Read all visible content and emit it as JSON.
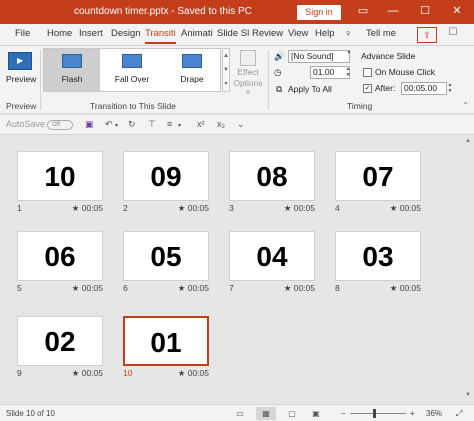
{
  "window": {
    "title": "countdown timer.pptx  -  Saved to this PC",
    "signin_label": "Sign in",
    "restore_icon": "restore-icon",
    "min_icon": "minimize-icon",
    "max_icon": "maximize-icon",
    "close_icon": "close-icon"
  },
  "tabs": [
    {
      "label": "File"
    },
    {
      "label": "Home"
    },
    {
      "label": "Insert"
    },
    {
      "label": "Design"
    },
    {
      "label": "Transiti"
    },
    {
      "label": "Animati"
    },
    {
      "label": "Slide Sl"
    },
    {
      "label": "Review"
    },
    {
      "label": "View"
    },
    {
      "label": "Help"
    }
  ],
  "tell_me": "Tell me",
  "ribbon": {
    "preview_label": "Preview",
    "preview_group": "Preview",
    "transitions": [
      {
        "label": "Flash",
        "selected": true
      },
      {
        "label": "Fall Over",
        "selected": false
      },
      {
        "label": "Drape",
        "selected": false
      }
    ],
    "transition_group": "Transition to This Slide",
    "effect_options_line1": "Effect",
    "effect_options_line2": "Options ˅",
    "sound_value": "[No Sound]",
    "duration_value": "01.00",
    "apply_to_all": "Apply To All",
    "advance_slide": "Advance Slide",
    "on_mouse_click": "On Mouse Click",
    "after_label": "After:",
    "after_value": "00:05.00",
    "timing_group": "Timing"
  },
  "qat": {
    "autosave_label": "AutoSave",
    "autosave_state": "Off",
    "superscript": "x²",
    "subscript": "x₂"
  },
  "slides": [
    {
      "number": "10",
      "index": "1",
      "duration": "00:05"
    },
    {
      "number": "09",
      "index": "2",
      "duration": "00:05"
    },
    {
      "number": "08",
      "index": "3",
      "duration": "00:05"
    },
    {
      "number": "07",
      "index": "4",
      "duration": "00:05"
    },
    {
      "number": "06",
      "index": "5",
      "duration": "00:05"
    },
    {
      "number": "05",
      "index": "6",
      "duration": "00:05"
    },
    {
      "number": "04",
      "index": "7",
      "duration": "00:05"
    },
    {
      "number": "03",
      "index": "8",
      "duration": "00:05"
    },
    {
      "number": "02",
      "index": "9",
      "duration": "00:05"
    },
    {
      "number": "01",
      "index": "10",
      "duration": "00:05"
    }
  ],
  "selected_slide_index": 9,
  "status": {
    "slide_info": "Slide 10 of 10",
    "zoom": "36%",
    "zoom_out": "−",
    "zoom_in": "+"
  },
  "colors": {
    "accent": "#c43e1c",
    "ribbon_bg": "#f3f3f3",
    "canvas_bg": "#e6e6e6"
  }
}
